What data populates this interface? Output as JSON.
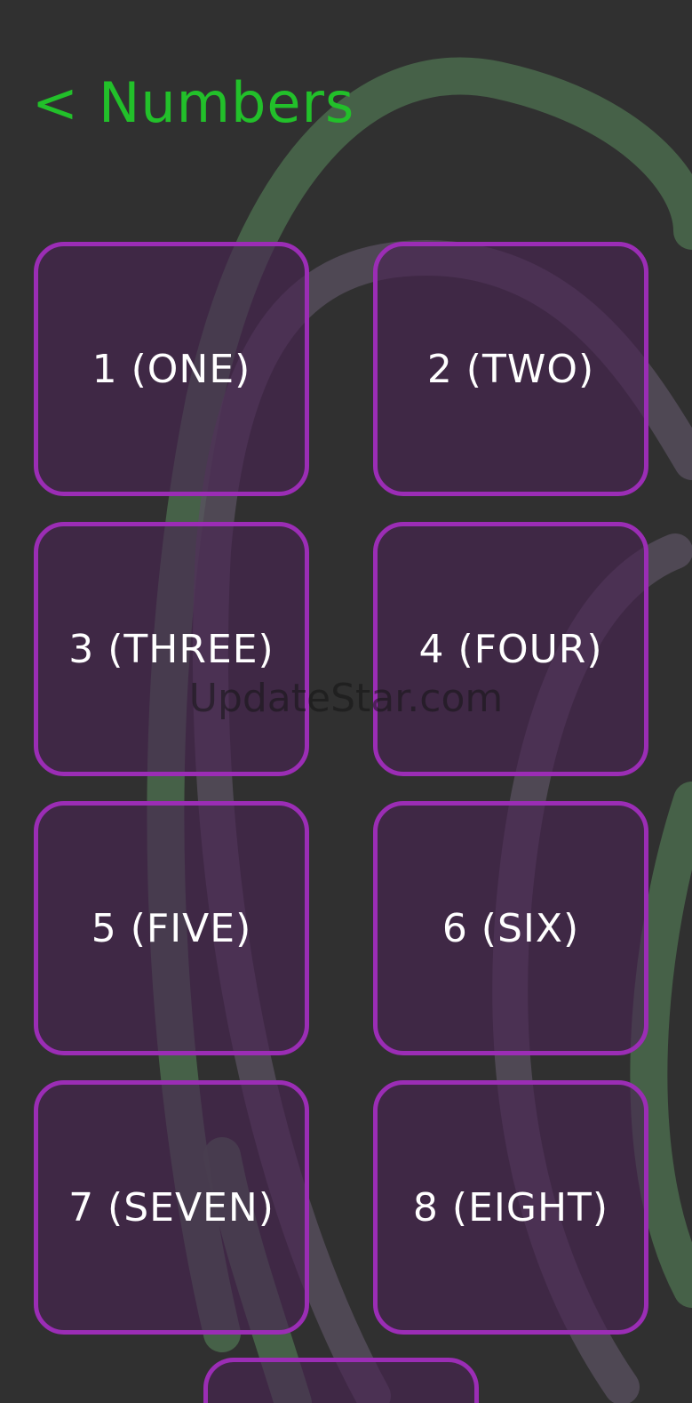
{
  "header": {
    "back_label": "<",
    "title": "Numbers"
  },
  "tiles": [
    {
      "label": "1 (ONE)"
    },
    {
      "label": "2 (TWO)"
    },
    {
      "label": "3 (THREE)"
    },
    {
      "label": "4 (FOUR)"
    },
    {
      "label": "5 (FIVE)"
    },
    {
      "label": "6 (SIX)"
    },
    {
      "label": "7 (SEVEN)"
    },
    {
      "label": "8 (EIGHT)"
    },
    {
      "label": ""
    }
  ],
  "watermark": {
    "text": "UpdateStar.com"
  },
  "colors": {
    "background": "#303030",
    "accent_green": "#22c02a",
    "tile_border": "#9b2db5",
    "tile_fill": "#482452",
    "swirl_green": "#4a6a4c",
    "swirl_gray": "#5a5060"
  }
}
